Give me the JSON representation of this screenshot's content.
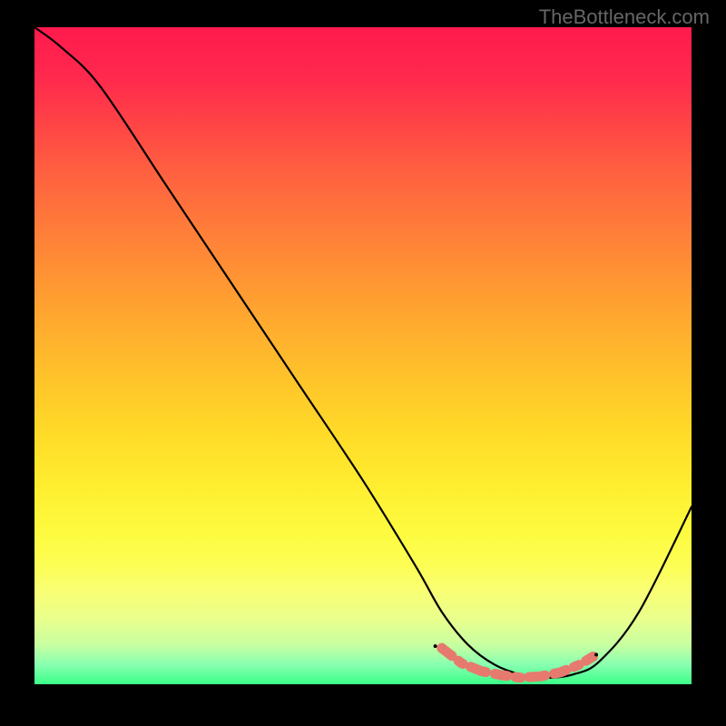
{
  "watermark": "TheBottleneck.com",
  "chart_data": {
    "type": "line",
    "title": "",
    "xlabel": "",
    "ylabel": "",
    "xlim": [
      0,
      100
    ],
    "ylim": [
      0,
      100
    ],
    "series": [
      {
        "name": "bottleneck-curve",
        "x": [
          0,
          4,
          10,
          20,
          30,
          40,
          50,
          58,
          62,
          66,
          70,
          74,
          78,
          82,
          86,
          92,
          100
        ],
        "values": [
          100,
          97,
          91,
          76,
          61,
          46,
          31,
          18,
          11,
          6,
          3,
          1.5,
          1,
          1.5,
          3.5,
          11,
          27
        ]
      }
    ],
    "trough_markers": {
      "x": [
        62,
        65,
        68,
        71,
        74,
        77,
        80,
        83,
        85
      ],
      "values": [
        5.5,
        3.2,
        2.0,
        1.4,
        1.0,
        1.2,
        1.8,
        3.0,
        4.2
      ]
    },
    "gradient_stops": [
      {
        "pos": 0,
        "color": "#ff1a4d"
      },
      {
        "pos": 50,
        "color": "#ffc028"
      },
      {
        "pos": 80,
        "color": "#fdfe55"
      },
      {
        "pos": 100,
        "color": "#3bff88"
      }
    ]
  }
}
